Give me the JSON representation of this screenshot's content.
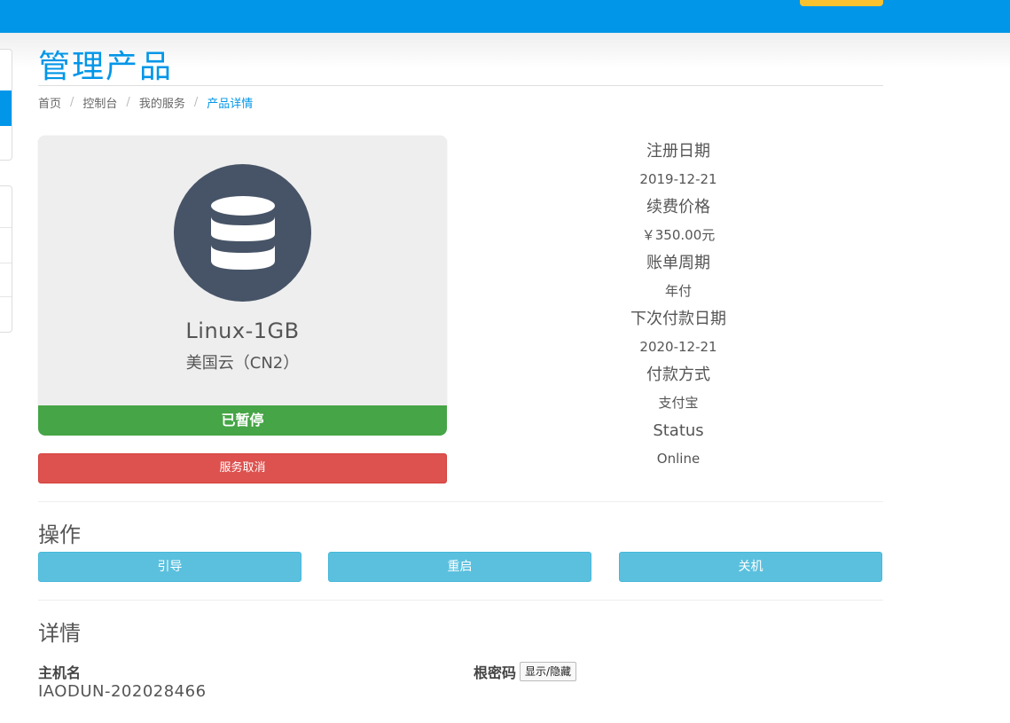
{
  "page": {
    "title": "管理产品"
  },
  "breadcrumb": [
    "首页",
    "控制台",
    "我的服务",
    "产品详情"
  ],
  "product": {
    "icon": "database-icon",
    "name": "Linux-1GB",
    "group": "美国云（CN2）",
    "status": "已暂停",
    "cancel_label": "服务取消"
  },
  "info": [
    {
      "label": "注册日期",
      "value": "2019-12-21"
    },
    {
      "label": "续费价格",
      "value": "￥350.00元"
    },
    {
      "label": "账单周期",
      "value": "年付"
    },
    {
      "label": "下次付款日期",
      "value": "2020-12-21"
    },
    {
      "label": "付款方式",
      "value": "支付宝"
    },
    {
      "label": "Status",
      "value": "Online"
    }
  ],
  "operations": {
    "title": "操作",
    "buttons": [
      "引导",
      "重启",
      "关机"
    ]
  },
  "details": {
    "title": "详情",
    "hostname_label": "主机名",
    "hostname_value": "IAODUN-202028466",
    "root_password_label": "根密码",
    "toggle_label": "显示/隐藏"
  },
  "colors": {
    "brand": "#0296e8",
    "accent": "#f9c22e",
    "status_paused": "#46a546",
    "danger": "#dd524f",
    "info": "#5bc0de",
    "icon_circle": "#475467"
  }
}
